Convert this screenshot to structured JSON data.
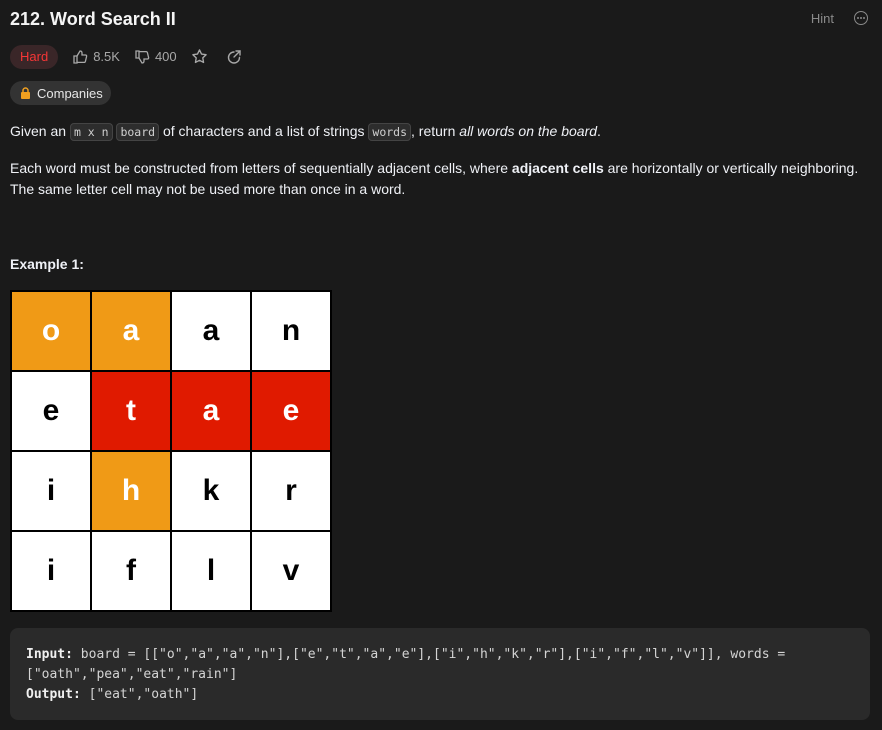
{
  "header": {
    "title": "212. Word Search II",
    "hint_label": "Hint"
  },
  "meta": {
    "difficulty": "Hard",
    "likes": "8.5K",
    "dislikes": "400",
    "companies_label": "Companies"
  },
  "description": {
    "p1_pre": "Given an ",
    "p1_code1": "m x n",
    "p1_code2": "board",
    "p1_mid": " of characters and a list of strings ",
    "p1_code3": "words",
    "p1_post": ", return ",
    "p1_em": "all words on the board",
    "p1_end": ".",
    "p2_pre": "Each word must be constructed from letters of sequentially adjacent cells, where ",
    "p2_bold": "adjacent cells",
    "p2_post": " are horizontally or vertically neighboring. The same letter cell may not be used more than once in a word."
  },
  "example": {
    "title": "Example 1:",
    "board": [
      [
        "o",
        "a",
        "a",
        "n"
      ],
      [
        "e",
        "t",
        "a",
        "e"
      ],
      [
        "i",
        "h",
        "k",
        "r"
      ],
      [
        "i",
        "f",
        "l",
        "v"
      ]
    ],
    "highlight": [
      [
        "orange",
        "orange",
        "white",
        "white"
      ],
      [
        "white",
        "red",
        "red",
        "red"
      ],
      [
        "white",
        "orange",
        "white",
        "white"
      ],
      [
        "white",
        "white",
        "white",
        "white"
      ]
    ],
    "input_label": "Input:",
    "input_text": " board = [[\"o\",\"a\",\"a\",\"n\"],[\"e\",\"t\",\"a\",\"e\"],[\"i\",\"h\",\"k\",\"r\"],[\"i\",\"f\",\"l\",\"v\"]], words = [\"oath\",\"pea\",\"eat\",\"rain\"]",
    "output_label": "Output:",
    "output_text": " [\"eat\",\"oath\"]"
  },
  "colors": {
    "orange": "#f09a16",
    "red": "#e01a00",
    "difficulty": "#f63636"
  }
}
